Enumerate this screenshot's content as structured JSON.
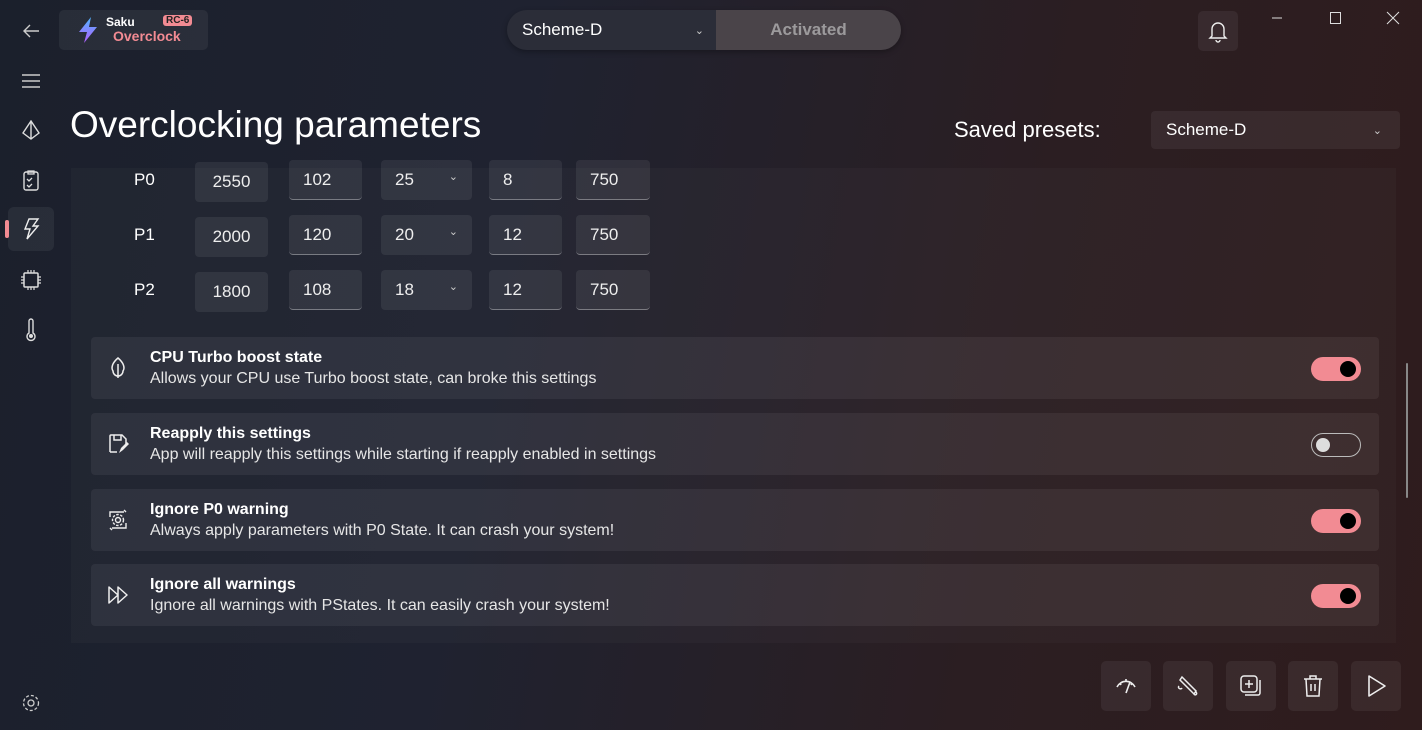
{
  "app": {
    "name_top": "Saku",
    "name_bottom": "Overclock",
    "badge": "RC-6"
  },
  "header": {
    "preset_select": "Scheme-D",
    "status_button": "Activated"
  },
  "page": {
    "title": "Overclocking parameters",
    "saved_presets_label": "Saved presets:",
    "saved_presets_value": "Scheme-D"
  },
  "pstates": [
    {
      "label": "P0",
      "freq": "2550",
      "fid": "102",
      "did": "25",
      "vid": "8",
      "extra": "750"
    },
    {
      "label": "P1",
      "freq": "2000",
      "fid": "120",
      "did": "20",
      "vid": "12",
      "extra": "750"
    },
    {
      "label": "P2",
      "freq": "1800",
      "fid": "108",
      "did": "18",
      "vid": "12",
      "extra": "750"
    }
  ],
  "settings": [
    {
      "title": "CPU Turbo boost state",
      "desc": "Allows your CPU use Turbo boost state, can broke this settings",
      "on": true,
      "icon": "leaf-icon"
    },
    {
      "title": "Reapply this settings",
      "desc": "App will reapply this settings while starting if reapply enabled in settings",
      "on": false,
      "icon": "save-edit-icon"
    },
    {
      "title": "Ignore P0 warning",
      "desc": "Always apply parameters with P0 State. It can crash your system!",
      "on": true,
      "icon": "gear-sync-icon"
    },
    {
      "title": "Ignore all warnings",
      "desc": "Ignore all warnings with PStates. It can easily crash your system!",
      "on": true,
      "icon": "fast-forward-icon"
    }
  ],
  "colors": {
    "accent": "#f28b93"
  }
}
